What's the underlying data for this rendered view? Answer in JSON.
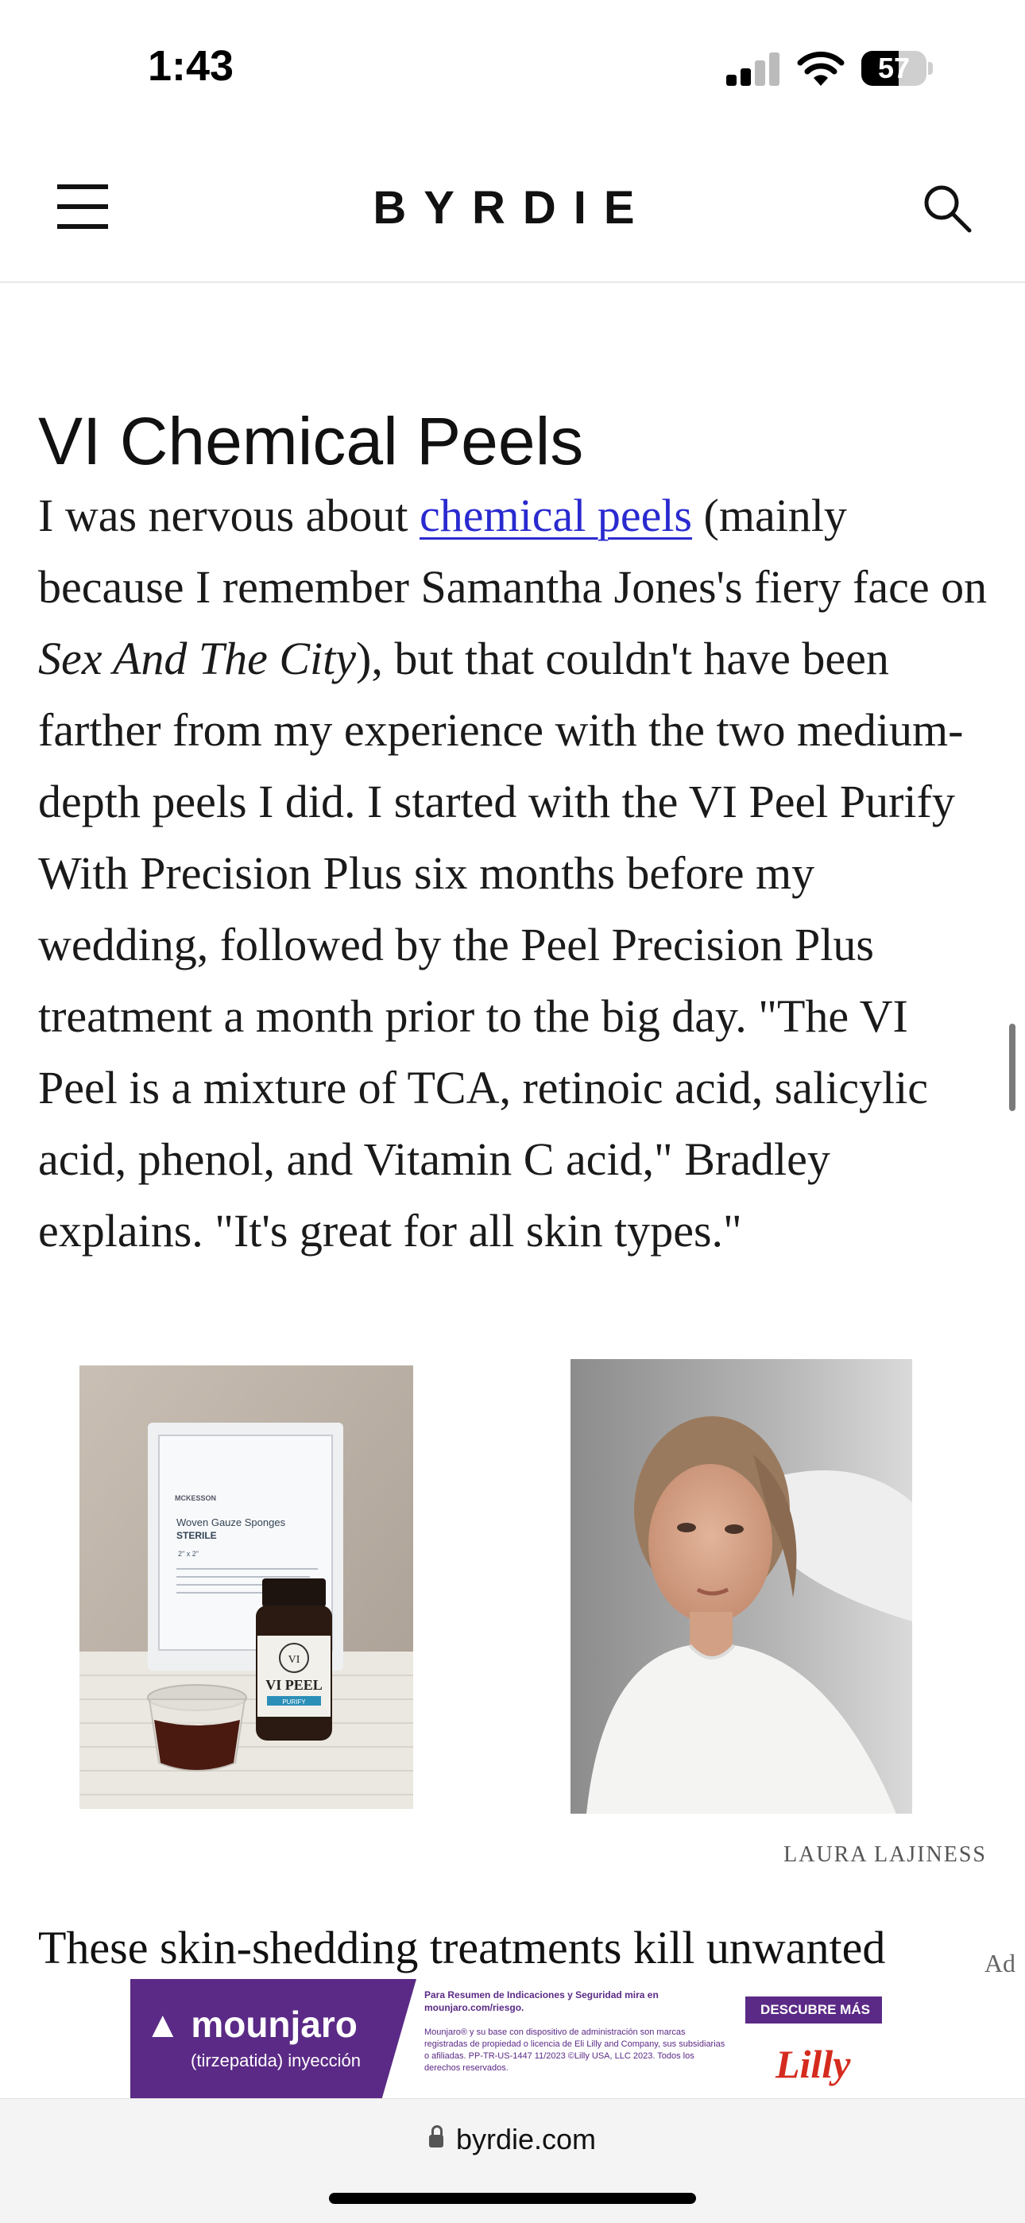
{
  "status_bar": {
    "time": "1:43",
    "battery_percent": "57",
    "battery_level": 0.57
  },
  "header": {
    "logo": "BYRDIE",
    "menu_icon": "hamburger-menu-icon",
    "search_icon": "search-icon"
  },
  "article": {
    "heading": "VI Chemical Peels",
    "para_before_link": "I was nervous about ",
    "link_text": "chemical peels",
    "para_after_link": " (mainly because I remember Samantha Jones's fiery face on ",
    "italic_text": "Sex And The City",
    "para_rest": "), but that couldn't have been farther from my experience with the two medium-depth peels I did. I started with the VI Peel Purify With Precision Plus six months before my wedding, followed by the Peel Precision Plus treatment a month prior to the big day. \"The VI Peel is a mixture of TCA, retinoic acid, salicylic acid, phenol, and Vitamin C acid,\" Bradley explains. \"It's great for all skin types.\"",
    "photo_credit": "LAURA LAJINESS",
    "next_paragraph_start": "These skin-shedding treatments kill unwanted"
  },
  "product_photo": {
    "packet_brand": "MCKESSON",
    "packet_title": "Woven Gauze Sponges",
    "packet_sub": "STERILE",
    "packet_size": "2\" x 2\"",
    "bottle_label": "VI PEEL",
    "bottle_sub": "PURIFY",
    "bottle_monogram": "VI"
  },
  "ad": {
    "label": "Ad",
    "brand": "mounjaro",
    "brand_sub": "(tirzepatida) inyección",
    "headline": "Para Resumen de Indicaciones y Seguridad mira en mounjaro.com/riesgo.",
    "fine_print": "Mounjaro® y su base con dispositivo de administración son marcas registradas de propiedad o licencia de Eli Lilly and Company, sus subsidiarias o afiliadas. PP-TR-US-1447 11/2023 ©Lilly USA, LLC 2023. Todos los derechos reservados.",
    "cta": "DESCUBRE MÁS",
    "sponsor": "Lilly"
  },
  "browser": {
    "url": "byrdie.com"
  },
  "colors": {
    "link": "#2a2ad0",
    "ad_purple": "#5b2a86",
    "lilly_red": "#d52b1e"
  }
}
